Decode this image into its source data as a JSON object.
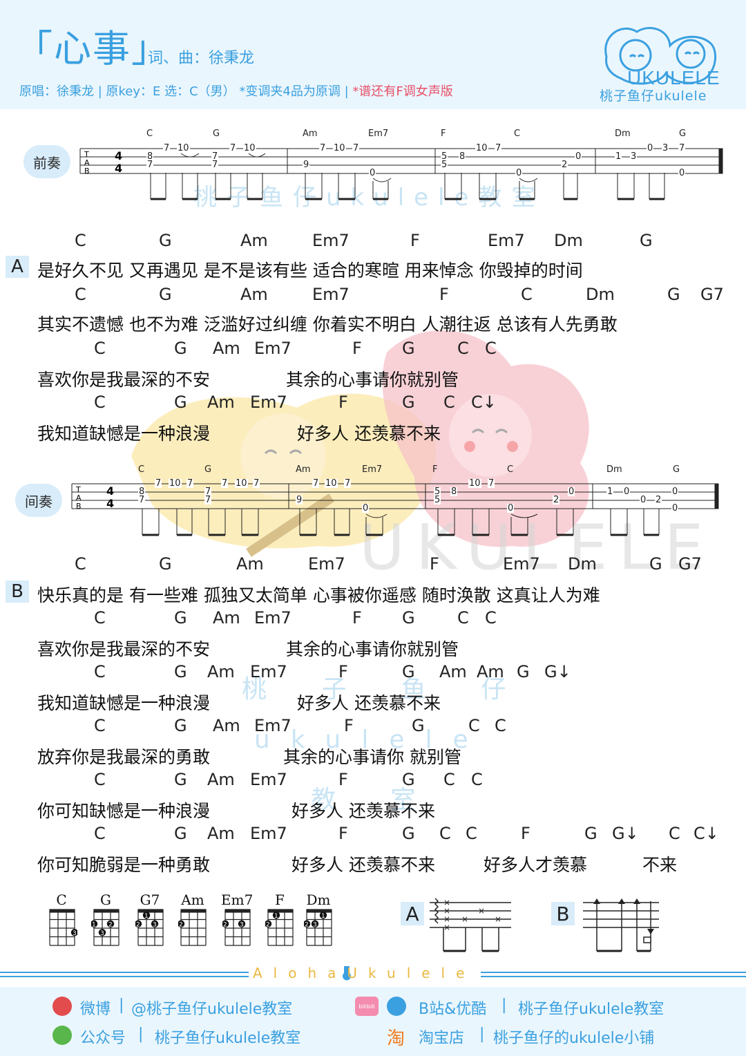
{
  "header": {
    "title": "「心事」",
    "credits": "词、曲：徐秉龙",
    "info_main": "原唱：徐秉龙 | 原key：E  选：C（男）  *变调夹4品为原调 |",
    "info_red": " *谱还有F调女声版",
    "brand": "桃子鱼仔ukulele",
    "logo_text": "UKULELE"
  },
  "watermark": {
    "line1": "桃子鱼仔ukulele教室",
    "line2": "桃 子 鱼 仔",
    "line3": "ukulele",
    "line4": "教 室",
    "big": "UKULELE"
  },
  "intro": {
    "label": "前奏",
    "chords": [
      "C",
      "G",
      "Am",
      "Em7",
      "F",
      "C",
      "Dm",
      "G"
    ]
  },
  "interlude": {
    "label": "间奏",
    "chords": [
      "C",
      "G",
      "Am",
      "Em7",
      "F",
      "C",
      "Dm",
      "G"
    ]
  },
  "sectionA": {
    "label": "A",
    "lines": [
      {
        "chords": [
          "C",
          "G",
          "Am",
          "Em7",
          "F",
          "Em7",
          "Dm",
          "G"
        ],
        "lyric": "是好久不见 又再遇见  是不是该有些  适合的寒暄  用来悼念  你毁掉的时间"
      },
      {
        "chords": [
          "C",
          "G",
          "Am",
          "Em7",
          "F",
          "C",
          "Dm",
          "G",
          "G7"
        ],
        "lyric": "其实不遗憾 也不为难  泛滥好过纠缠    你着实不明白  人潮往返  总该有人先勇敢"
      },
      {
        "chords": [
          "C",
          "G",
          "Am",
          "Em7",
          "F",
          "G",
          "C",
          "C"
        ],
        "lyric": "喜欢你是我最深的不安"
      },
      {
        "chords": [],
        "lyric": "其余的心事请你就别管"
      },
      {
        "chords": [
          "C",
          "G",
          "Am",
          "Em7",
          "F",
          "G",
          "C",
          "C↓"
        ],
        "lyric": "我知道缺憾是一种浪漫"
      },
      {
        "chords": [],
        "lyric": "好多人  还羡慕不来"
      }
    ]
  },
  "sectionB": {
    "label": "B",
    "lines": [
      {
        "chords": [
          "C",
          "G",
          "Am",
          "Em7",
          "F",
          "Em7",
          "Dm",
          "G",
          "G7"
        ],
        "lyric": "快乐真的是 有一些难 孤独又太简单   心事被你遥感 随时涣散  这真让人为难"
      },
      {
        "chords": [
          "C",
          "G",
          "Am",
          "Em7",
          "F",
          "G",
          "C",
          "C"
        ],
        "lyric": "喜欢你是我最深的不安"
      },
      {
        "chords": [],
        "lyric": "其余的心事请你就别管"
      },
      {
        "chords": [
          "C",
          "G",
          "Am",
          "Em7",
          "F",
          "G",
          "Am",
          "Am",
          "G",
          "G↓"
        ],
        "lyric": "我知道缺憾是一种浪漫"
      },
      {
        "chords": [],
        "lyric": "好多人  还羡慕不来"
      },
      {
        "chords": [
          "C",
          "G",
          "Am",
          "Em7",
          "F",
          "G",
          "C",
          "C"
        ],
        "lyric": "放弃你是我最深的勇敢"
      },
      {
        "chords": [],
        "lyric": "其余的心事请你  就别管"
      },
      {
        "chords": [
          "C",
          "G",
          "Am",
          "Em7",
          "F",
          "G",
          "C",
          "C"
        ],
        "lyric": "你可知缺憾是一种浪漫"
      },
      {
        "chords": [],
        "lyric": "好多人  还羡慕不来"
      },
      {
        "chords": [
          "C",
          "G",
          "Am",
          "Em7",
          "F",
          "G",
          "C",
          "C",
          "F",
          "G",
          "G↓",
          "C",
          "C↓"
        ],
        "lyric": "你可知脆弱是一种勇敢"
      },
      {
        "chords": [],
        "lyric": "好多人  还羡慕不来"
      },
      {
        "chords": [],
        "lyric": "好多人才羡慕"
      },
      {
        "chords": [],
        "lyric": "不来"
      }
    ]
  },
  "chord_diagrams": [
    {
      "name": "C",
      "dots": [
        [
          3,
          4,
          "3"
        ]
      ]
    },
    {
      "name": "G",
      "dots": [
        [
          2,
          1,
          "1"
        ],
        [
          2,
          3,
          "2"
        ],
        [
          3,
          2,
          "3"
        ]
      ]
    },
    {
      "name": "G7",
      "dots": [
        [
          1,
          2,
          "1"
        ],
        [
          2,
          1,
          "2"
        ],
        [
          2,
          3,
          "3"
        ]
      ]
    },
    {
      "name": "Am",
      "dots": [
        [
          2,
          1,
          "2"
        ]
      ]
    },
    {
      "name": "Em7",
      "dots": [
        [
          2,
          1,
          "2"
        ],
        [
          2,
          3,
          "3"
        ]
      ]
    },
    {
      "name": "F",
      "dots": [
        [
          1,
          2,
          "1"
        ],
        [
          2,
          1,
          "2"
        ]
      ]
    },
    {
      "name": "Dm",
      "dots": [
        [
          1,
          3,
          "1"
        ],
        [
          2,
          1,
          "2"
        ],
        [
          2,
          2,
          "3"
        ]
      ]
    }
  ],
  "strum_patterns": [
    {
      "label": "A"
    },
    {
      "label": "B"
    }
  ],
  "footer": {
    "aloha": "AlohaUkulele",
    "weibo_label": "微博",
    "weibo_value": "@桃子鱼仔ukulele教室",
    "wechat_label": "公众号",
    "wechat_value": "桃子鱼仔ukulele教室",
    "bilibili_icon": "bilibili",
    "video_label": "B站&优酷",
    "video_value": "桃子鱼仔ukulele教室",
    "taobao_icon": "淘",
    "taobao_label": "淘宝店",
    "taobao_value": "桃子鱼仔的ukulele小铺",
    "sep": "|"
  },
  "colors": {
    "accent": "#3aa0e0",
    "red": "#e8506a",
    "panel": "#eaf6fd",
    "gold": "#e9b840",
    "pink": "#f6c2c8",
    "yellow": "#fbe7a6"
  }
}
